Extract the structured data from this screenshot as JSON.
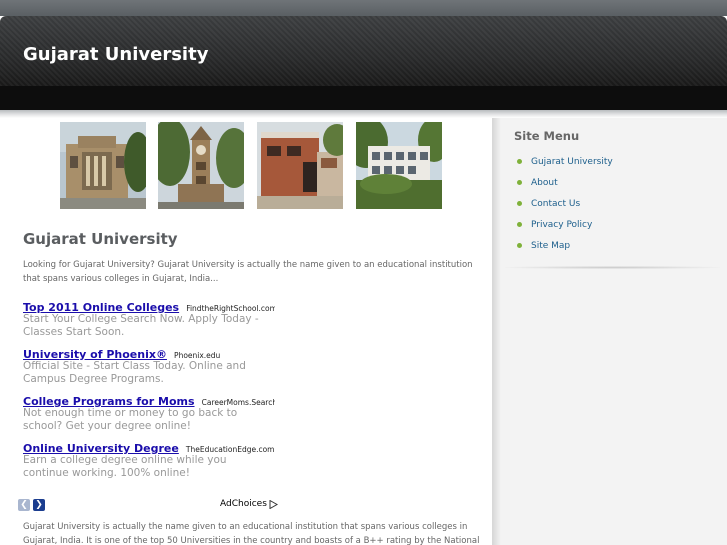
{
  "header": {
    "site_title": "Gujarat University"
  },
  "photos": [
    {
      "alt": "building-1",
      "icon": "photo"
    },
    {
      "alt": "tower",
      "icon": "photo"
    },
    {
      "alt": "brick-building",
      "icon": "photo"
    },
    {
      "alt": "white-building",
      "icon": "photo"
    }
  ],
  "main": {
    "title": "Gujarat University",
    "intro": "Looking for Gujarat University? Gujarat University is actually the name given to an educational institution that spans various colleges in Gujarat, India...",
    "body": "Gujarat University is actually the name given to an educational institution that spans various colleges in Gujarat, India. It is one of the top 50 Universities in the country and boasts of a B++ rating by the National"
  },
  "ads": {
    "items": [
      {
        "title": "Top 2011 Online Colleges",
        "url": "FindtheRightSchool.com/Co...",
        "desc": "Start Your College Search Now. Apply Today - Classes Start Soon."
      },
      {
        "title": "University of Phoenix®",
        "url": "Phoenix.edu",
        "desc": "Official Site - Start Class Today. Online and Campus Degree Programs."
      },
      {
        "title": "College Programs for Moms",
        "url": "CareerMoms.Search-Sch...",
        "desc": "Not enough time or money to go back to school? Get your degree online!"
      },
      {
        "title": "Online University Degree",
        "url": "TheEducationEdge.com",
        "desc": "Earn a college degree online while you continue working. 100% online!"
      }
    ],
    "prev_icon": "chevron-left-icon",
    "next_icon": "chevron-right-icon",
    "adchoices_label": "AdChoices"
  },
  "sidebar": {
    "title": "Site Menu",
    "items": [
      {
        "label": "Gujarat University"
      },
      {
        "label": "About"
      },
      {
        "label": "Contact Us"
      },
      {
        "label": "Privacy Policy"
      },
      {
        "label": "Site Map"
      }
    ],
    "bullet_color": "#7fb13a",
    "link_color": "#1d5f8c"
  }
}
